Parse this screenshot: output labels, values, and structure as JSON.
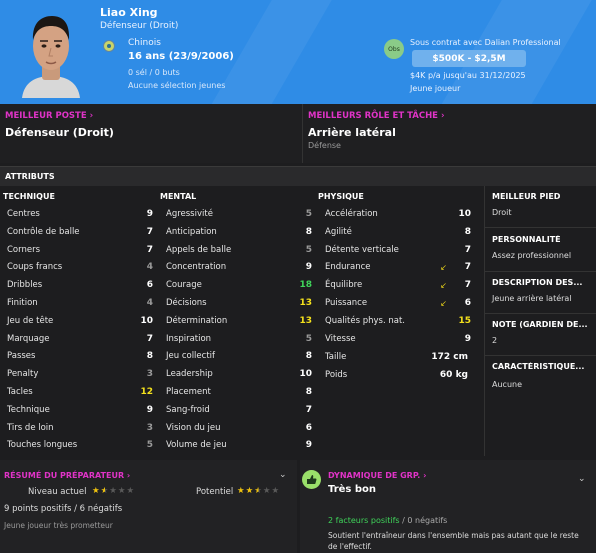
{
  "player": {
    "name": "Liao Xing",
    "position": "Défenseur (Droit)",
    "nation": "Chinois",
    "age": "16 ans (23/9/2006)",
    "caps": "0 sél / 0 buts",
    "youth_caps": "Aucune sélection jeunes",
    "contract": "Sous contrat avec Dalian Professional",
    "value": "$500K - $2,5M",
    "wage": "$4K p/a jusqu'au 31/12/2025",
    "status": "Jeune joueur",
    "obs_badge": "Obs"
  },
  "best_position": {
    "title": "MEILLEUR POSTE",
    "value": "Défenseur (Droit)"
  },
  "best_role": {
    "title": "MEILLEURS RÔLE ET TÂCHE",
    "value": "Arrière latéral",
    "sub": "Défense"
  },
  "attributes": {
    "header": "ATTRIBUTS",
    "technique": {
      "title": "TECHNIQUE",
      "rows": [
        {
          "name": "Centres",
          "value": "9",
          "color": "#ffffff"
        },
        {
          "name": "Contrôle de balle",
          "value": "7",
          "color": "#ffffff"
        },
        {
          "name": "Corners",
          "value": "7",
          "color": "#ffffff"
        },
        {
          "name": "Coups francs",
          "value": "4",
          "color": "#9a9a9a"
        },
        {
          "name": "Dribbles",
          "value": "6",
          "color": "#ffffff"
        },
        {
          "name": "Finition",
          "value": "4",
          "color": "#9a9a9a"
        },
        {
          "name": "Jeu de tête",
          "value": "10",
          "color": "#ffffff"
        },
        {
          "name": "Marquage",
          "value": "7",
          "color": "#ffffff"
        },
        {
          "name": "Passes",
          "value": "8",
          "color": "#ffffff"
        },
        {
          "name": "Penalty",
          "value": "3",
          "color": "#9a9a9a"
        },
        {
          "name": "Tacles",
          "value": "12",
          "color": "#f4e11c"
        },
        {
          "name": "Technique",
          "value": "9",
          "color": "#ffffff"
        },
        {
          "name": "Tirs de loin",
          "value": "3",
          "color": "#9a9a9a"
        },
        {
          "name": "Touches longues",
          "value": "5",
          "color": "#9a9a9a"
        }
      ]
    },
    "mental": {
      "title": "MENTAL",
      "rows": [
        {
          "name": "Agressivité",
          "value": "5",
          "color": "#9a9a9a"
        },
        {
          "name": "Anticipation",
          "value": "8",
          "color": "#ffffff"
        },
        {
          "name": "Appels de balle",
          "value": "5",
          "color": "#9a9a9a"
        },
        {
          "name": "Concentration",
          "value": "9",
          "color": "#ffffff"
        },
        {
          "name": "Courage",
          "value": "18",
          "color": "#3fd45a"
        },
        {
          "name": "Décisions",
          "value": "13",
          "color": "#f4e11c"
        },
        {
          "name": "Détermination",
          "value": "13",
          "color": "#f4e11c"
        },
        {
          "name": "Inspiration",
          "value": "5",
          "color": "#9a9a9a"
        },
        {
          "name": "Jeu collectif",
          "value": "8",
          "color": "#ffffff"
        },
        {
          "name": "Leadership",
          "value": "10",
          "color": "#ffffff"
        },
        {
          "name": "Placement",
          "value": "8",
          "color": "#ffffff"
        },
        {
          "name": "Sang-froid",
          "value": "7",
          "color": "#ffffff"
        },
        {
          "name": "Vision du jeu",
          "value": "6",
          "color": "#ffffff"
        },
        {
          "name": "Volume de jeu",
          "value": "9",
          "color": "#ffffff"
        }
      ]
    },
    "physique": {
      "title": "PHYSIQUE",
      "rows": [
        {
          "name": "Accélération",
          "value": "10",
          "color": "#ffffff",
          "arrow": false
        },
        {
          "name": "Agilité",
          "value": "8",
          "color": "#ffffff",
          "arrow": false
        },
        {
          "name": "Détente verticale",
          "value": "7",
          "color": "#ffffff",
          "arrow": false
        },
        {
          "name": "Endurance",
          "value": "7",
          "color": "#ffffff",
          "arrow": true
        },
        {
          "name": "Équilibre",
          "value": "7",
          "color": "#ffffff",
          "arrow": true
        },
        {
          "name": "Puissance",
          "value": "6",
          "color": "#ffffff",
          "arrow": true
        },
        {
          "name": "Qualités phys. nat.",
          "value": "15",
          "color": "#f4e11c",
          "arrow": false
        },
        {
          "name": "Vitesse",
          "value": "9",
          "color": "#ffffff",
          "arrow": false
        }
      ],
      "height_label": "Taille",
      "height": "172 cm",
      "weight_label": "Poids",
      "weight": "60 kg"
    }
  },
  "side": {
    "foot_title": "MEILLEUR PIED",
    "foot": "Droit",
    "personality_title": "PERSONNALITÉ",
    "personality": "Assez professionnel",
    "description_title": "DESCRIPTION DES...",
    "description": "Jeune arrière latéral",
    "gk_title": "NOTE (GARDIEN DE...",
    "gk": "2",
    "traits_title": "CARACTÉRISTIQUE...",
    "traits": "Aucune"
  },
  "coach_report": {
    "title": "RÉSUMÉ DU PRÉPARATEUR",
    "current_label": "Niveau actuel",
    "current_stars": 1.5,
    "potential_label": "Potentiel",
    "potential_stars": 2.5,
    "points": "9 points positifs / 6 négatifs",
    "summary": "Jeune joueur très prometteur"
  },
  "group_dynamics": {
    "title": "DYNAMIQUE DE GRP.",
    "status": "Très bon",
    "positives": "2 facteurs positifs",
    "separator": " / ",
    "negatives": "0 négatifs",
    "description": "Soutient l'entraîneur dans l'ensemble mais pas autant que le reste de l'effectif."
  },
  "colors": {
    "header_bg": "#2f8ce6",
    "accent_title": "#e033c7",
    "good": "#3fd45a",
    "medium": "#f4e11c"
  }
}
